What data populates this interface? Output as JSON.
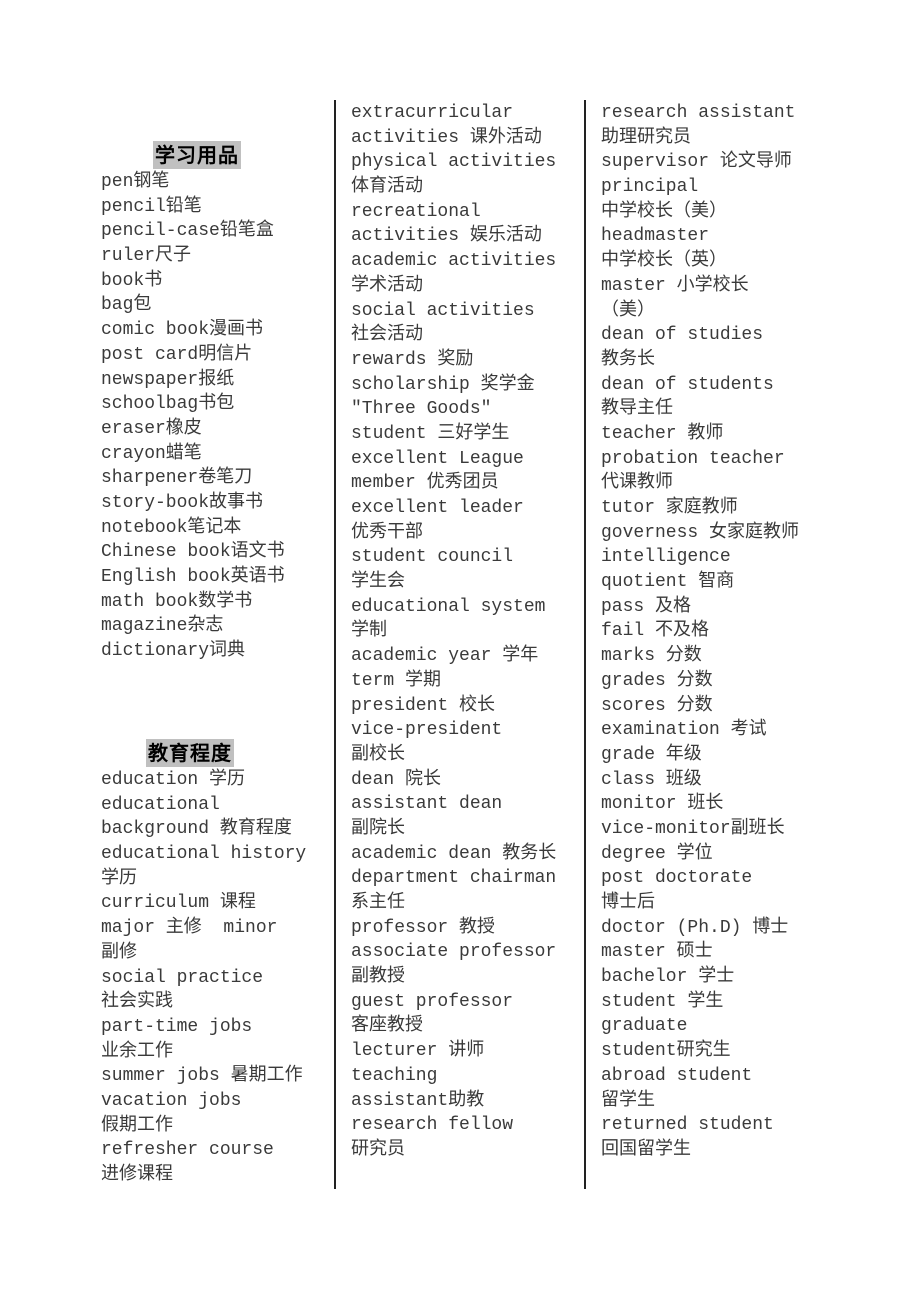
{
  "sections": {
    "school_supplies": {
      "title": "学习用品",
      "items": [
        "pen钢笔",
        "pencil铅笔",
        "pencil-case铅笔盒",
        "ruler尺子",
        "book书",
        "bag包",
        "comic book漫画书",
        "post card明信片",
        "newspaper报纸",
        "schoolbag书包",
        "eraser橡皮",
        "crayon蜡笔",
        "sharpener卷笔刀",
        "story-book故事书",
        "notebook笔记本",
        "Chinese book语文书",
        "English book英语书",
        "math book数学书",
        "magazine杂志",
        "dictionary词典"
      ]
    },
    "education_level": {
      "title": "教育程度",
      "items": [
        "education 学历",
        "educational",
        "background 教育程度",
        "educational history",
        "学历",
        "curriculum 课程",
        "major 主修  minor",
        "副修",
        "social practice",
        "社会实践",
        "part-time jobs",
        "业余工作",
        "summer jobs 暑期工作",
        "vacation jobs",
        "假期工作",
        "refresher course",
        "进修课程"
      ]
    }
  },
  "column2": {
    "items": [
      "extracurricular",
      "activities 课外活动",
      "physical activities",
      "体育活动",
      "recreational",
      "activities 娱乐活动",
      "academic activities",
      "学术活动",
      "social activities",
      "社会活动",
      "rewards 奖励",
      "scholarship 奖学金",
      "\"Three Goods\"",
      "student 三好学生",
      "excellent League",
      "member 优秀团员",
      "excellent leader",
      "优秀干部",
      "student council",
      "学生会",
      "educational system",
      "学制",
      "academic year 学年",
      "term 学期",
      "president 校长",
      "vice-president",
      "副校长",
      "dean 院长",
      "assistant dean",
      "副院长",
      "academic dean 教务长",
      "department chairman",
      "系主任",
      "professor 教授",
      "associate professor",
      "副教授",
      "guest professor",
      "客座教授",
      "lecturer 讲师",
      "teaching",
      "assistant助教",
      "research fellow",
      "研究员"
    ]
  },
  "column3": {
    "items": [
      "research assistant",
      "助理研究员",
      "supervisor 论文导师",
      "principal",
      "中学校长（美）",
      "headmaster",
      "中学校长（英）",
      "master 小学校长",
      "（美）",
      "dean of studies",
      "教务长",
      "dean of students",
      "教导主任",
      "teacher 教师",
      "probation teacher",
      "代课教师",
      "tutor 家庭教师",
      "governess 女家庭教师",
      "intelligence",
      "quotient 智商",
      "pass 及格",
      "fail 不及格",
      "marks 分数",
      "grades 分数",
      "scores 分数",
      "examination 考试",
      "grade 年级",
      "class 班级",
      "monitor 班长",
      "vice-monitor副班长",
      "degree 学位",
      "post doctorate",
      "博士后",
      "doctor (Ph.D) 博士",
      "master 硕士",
      "bachelor 学士",
      "student 学生",
      "graduate",
      "student研究生",
      "abroad student",
      "留学生",
      "returned student",
      "回国留学生"
    ]
  }
}
